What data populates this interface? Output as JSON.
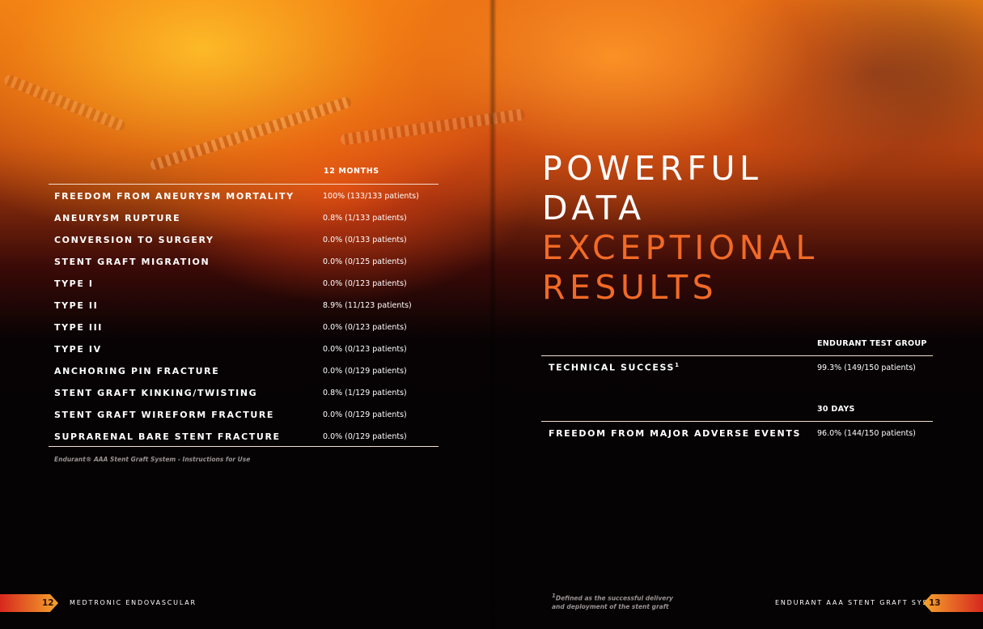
{
  "left_table": {
    "column_header": "12 MONTHS",
    "rows": [
      {
        "label": "FREEDOM FROM ANEURYSM MORTALITY",
        "value": "100% (133/133 patients)"
      },
      {
        "label": "ANEURYSM RUPTURE",
        "value": "0.8% (1/133 patients)"
      },
      {
        "label": "CONVERSION TO SURGERY",
        "value": "0.0% (0/133 patients)"
      },
      {
        "label": "STENT GRAFT MIGRATION",
        "value": "0.0% (0/125 patients)"
      },
      {
        "label": "TYPE I",
        "value": "0.0% (0/123 patients)"
      },
      {
        "label": "TYPE II",
        "value": "8.9% (11/123 patients)"
      },
      {
        "label": "TYPE III",
        "value": "0.0% (0/123 patients)"
      },
      {
        "label": "TYPE IV",
        "value": "0.0% (0/123 patients)"
      },
      {
        "label": "ANCHORING PIN FRACTURE",
        "value": "0.0% (0/129 patients)"
      },
      {
        "label": "STENT GRAFT KINKING/TWISTING",
        "value": "0.8% (1/129 patients)"
      },
      {
        "label": "STENT GRAFT WIREFORM FRACTURE",
        "value": "0.0% (0/129 patients)"
      },
      {
        "label": "SUPRARENAL BARE STENT FRACTURE",
        "value": "0.0% (0/129 patients)"
      }
    ],
    "source": "Endurant® AAA Stent Graft System - Instructions for Use"
  },
  "headline": {
    "line1": "POWERFUL",
    "line2": "DATA",
    "line3": "EXCEPTIONAL",
    "line4": "RESULTS"
  },
  "right_table": {
    "group1": {
      "header": "ENDURANT TEST GROUP",
      "label": "TECHNICAL SUCCESS",
      "sup": "1",
      "value": "99.3% (149/150 patients)"
    },
    "group2": {
      "header": "30 DAYS",
      "label": "FREEDOM FROM MAJOR ADVERSE EVENTS",
      "value": "96.0% (144/150 patients)"
    },
    "footnote_sup": "1",
    "footnote_line1": "Defined as the successful delivery",
    "footnote_line2": "and deployment of the stent graft"
  },
  "footer": {
    "left_page": "12",
    "left_text": "MEDTRONIC ENDOVASCULAR",
    "right_text": "ENDURANT AAA STENT GRAFT SYSTEM",
    "right_page": "13"
  },
  "colors": {
    "accent_orange": "#f26a26",
    "background": "#050304",
    "rule": "#f1ded0"
  }
}
